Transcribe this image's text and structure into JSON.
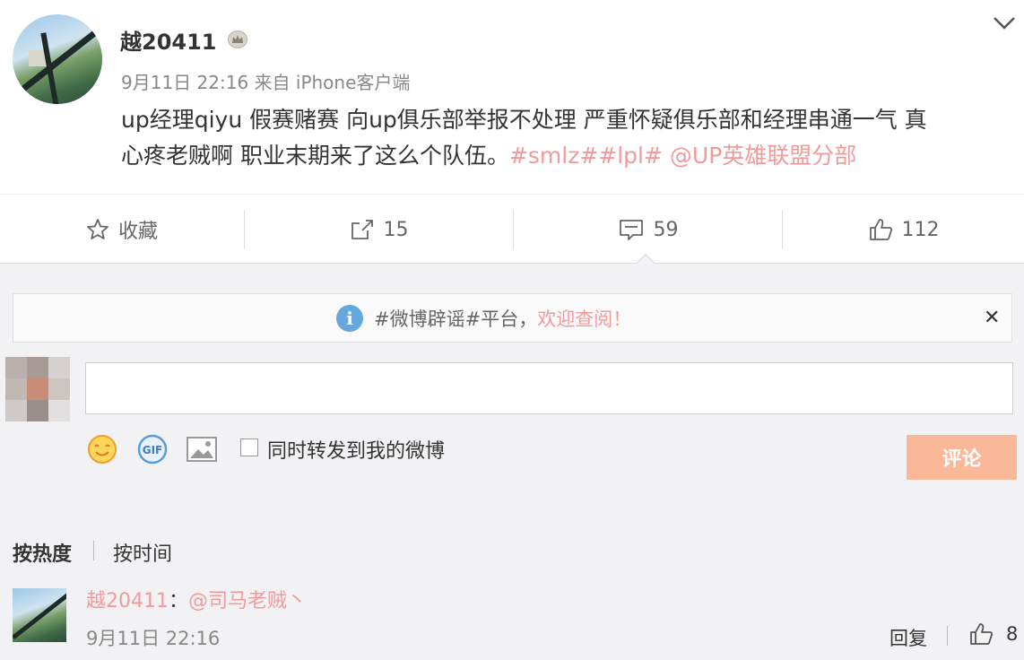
{
  "post": {
    "username": "越20411",
    "time": "9月11日 22:16",
    "source": "来自 iPhone客户端",
    "text_line1": "up经理qiyu 假赛赌赛 向up俱乐部举报不处理 严重怀疑俱乐部和经理串通一气 真",
    "text_line2": "心疼老贼啊 职业末期来了这么个队伍。",
    "tags": "#smlz##lpl#",
    "mention": "@UP英雄联盟分部"
  },
  "actions": {
    "favorite_label": "收藏",
    "repost_count": "15",
    "comment_count": "59",
    "like_count": "112"
  },
  "notice": {
    "text": "#微博辟谣#平台，",
    "link": "欢迎查阅！"
  },
  "composer": {
    "repost_label": "同时转发到我的微博",
    "submit_label": "评论"
  },
  "sort": {
    "hot": "按热度",
    "time": "按时间"
  },
  "comment": {
    "user": "越20411",
    "colon": "：",
    "mention": "@司马老贼丶",
    "time": "9月11日 22:16",
    "reply_label": "回复",
    "like_count": "8"
  },
  "colors": {
    "accent_pink": "#f09b9b",
    "submit_bg": "#fbb898",
    "info_blue": "#66a8de"
  }
}
